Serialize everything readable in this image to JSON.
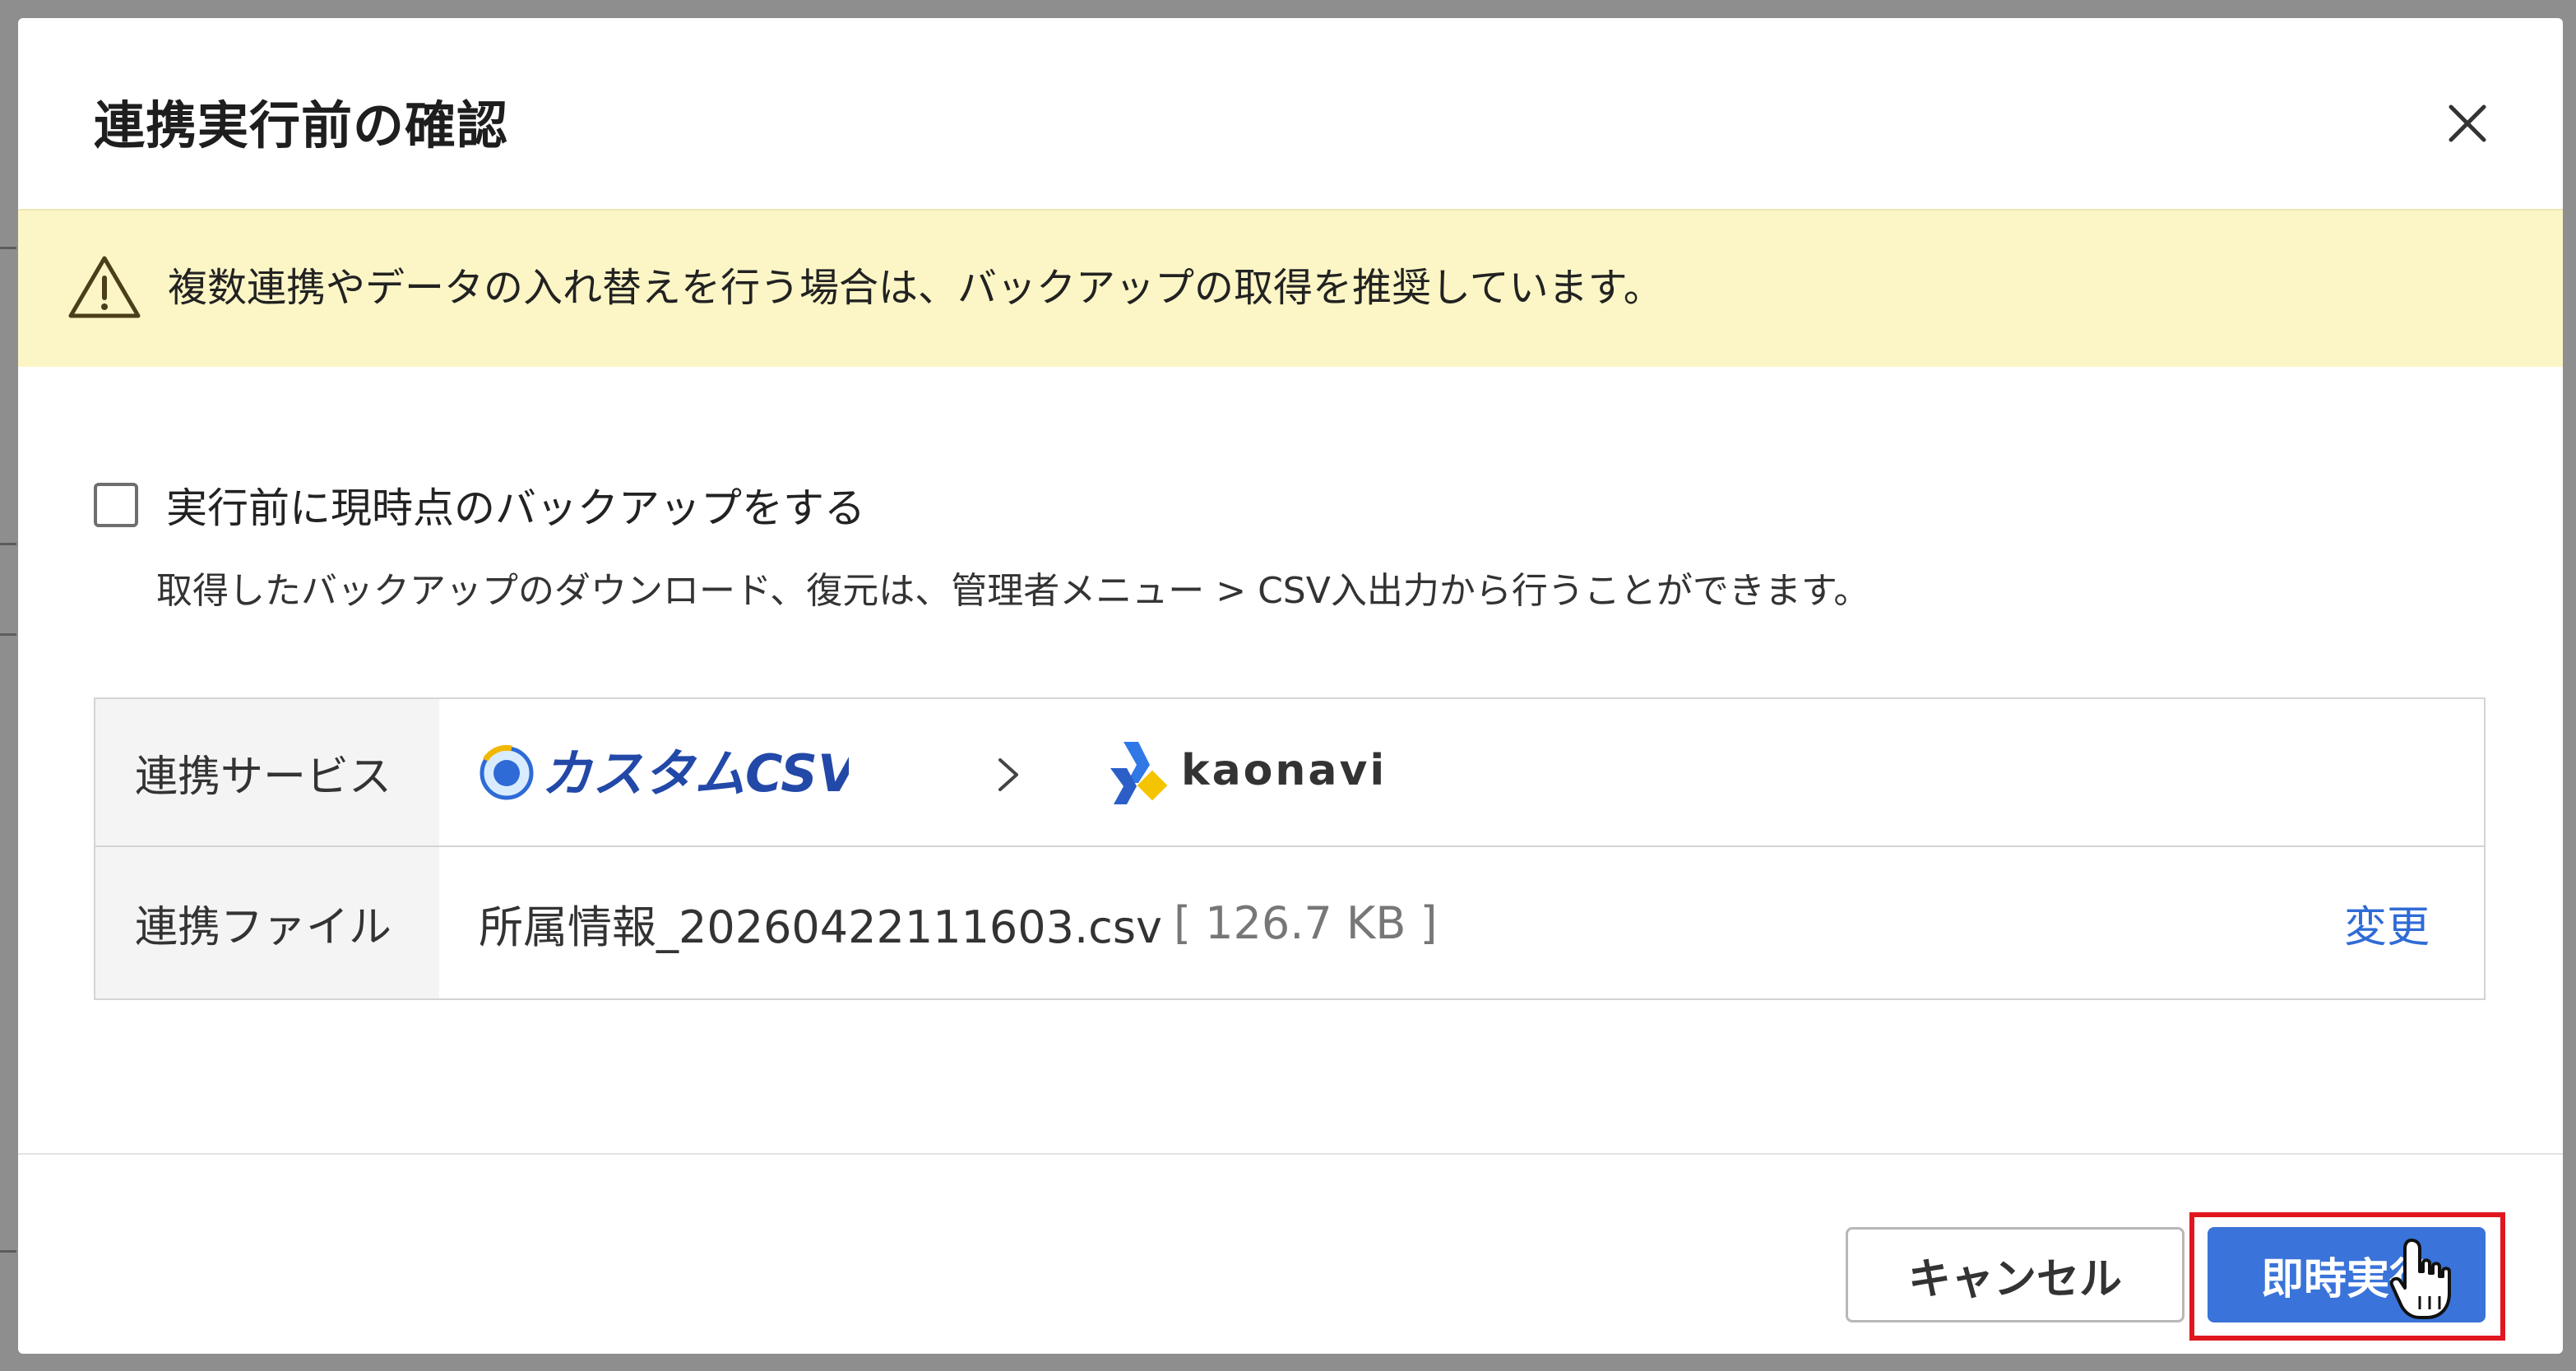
{
  "dialog": {
    "title": "連携実行前の確認",
    "close_label": "×"
  },
  "warning": {
    "icon": "warning-triangle-icon",
    "message": "複数連携やデータの入れ替えを行う場合は、バックアップの取得を推奨しています。"
  },
  "backup": {
    "checkbox_label": "実行前に現時点のバックアップをする",
    "checked": false,
    "note": "取得したバックアップのダウンロード、復元は、管理者メニュー > CSV入出力から行うことができます。"
  },
  "details": {
    "service_label": "連携サービス",
    "source_service": "カスタムCSV",
    "target_service": "kaonavi",
    "file_label": "連携ファイル",
    "file_name": "所属情報_20260422111603.csv",
    "file_size": "[ 126.7 KB ]",
    "change_label": "変更"
  },
  "footer": {
    "cancel_label": "キャンセル",
    "execute_label": "即時実行"
  },
  "colors": {
    "primary": "#3a73d9",
    "link": "#2f6bd6",
    "warning_bg": "#fcf6c6",
    "highlight": "#e0171f"
  }
}
